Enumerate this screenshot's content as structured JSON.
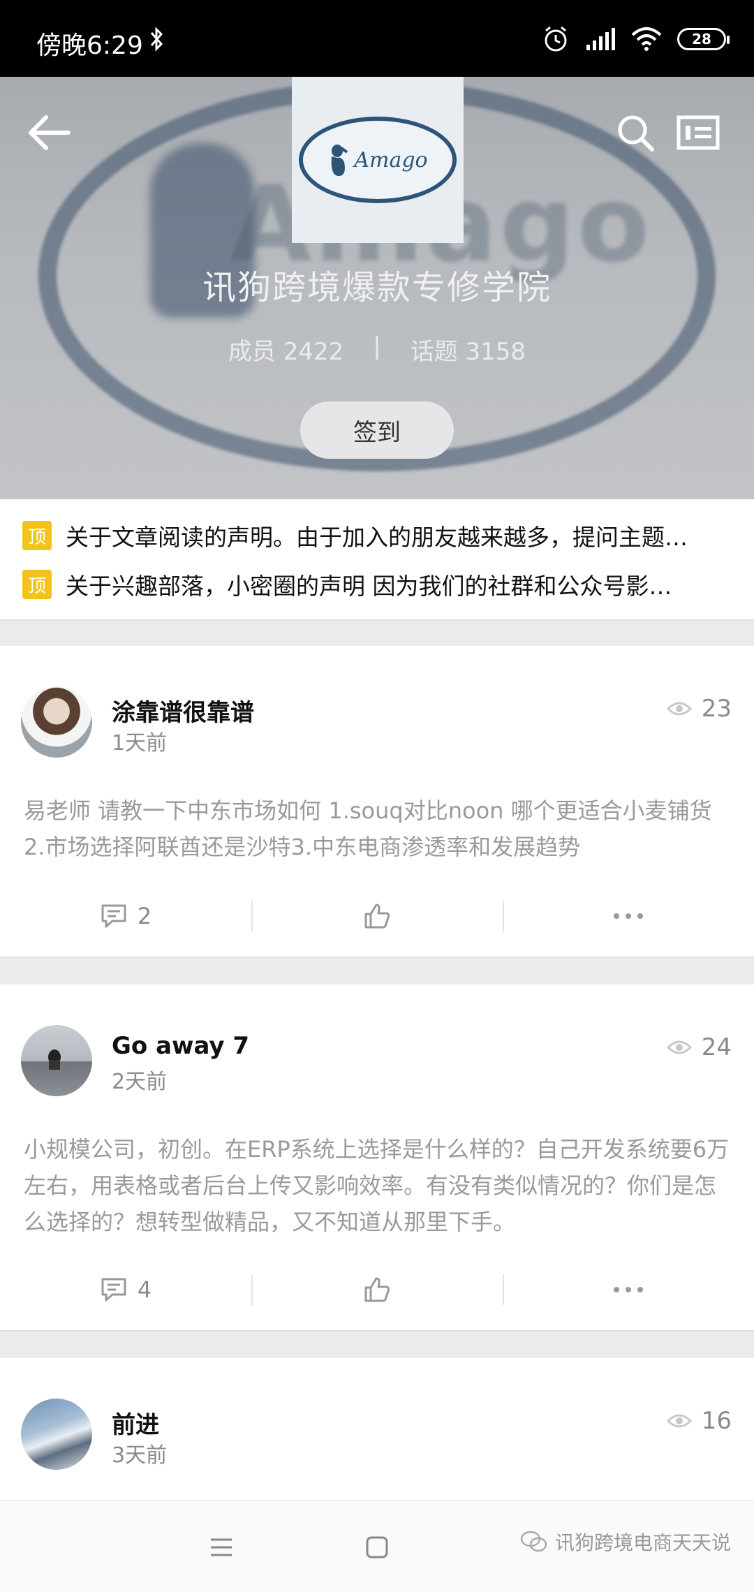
{
  "status_bar": {
    "time": "傍晚6:29",
    "battery": "28"
  },
  "group": {
    "logo_text": "Amago",
    "title": "讯狗跨境爆款专修学院",
    "members_label": "成员 2422",
    "separator": "|",
    "topics_label": "话题 3158",
    "checkin_label": "签到"
  },
  "pinned": [
    {
      "badge": "顶",
      "text": "关于文章阅读的声明。由于加入的朋友越来越多，提问主题…"
    },
    {
      "badge": "顶",
      "text": "关于兴趣部落，小密圈的声明 因为我们的社群和公众号影…"
    }
  ],
  "posts": [
    {
      "author": "涂靠谱很靠谱",
      "time": "1天前",
      "views": "23",
      "content": "易老师 请教一下中东市场如何 1.souq对比noon 哪个更适合小麦铺货 2.市场选择阿联酋还是沙特3.中东电商渗透率和发展趋势",
      "comments": "2"
    },
    {
      "author": "Go away 7",
      "time": "2天前",
      "views": "24",
      "content": "小规模公司，初创。在ERP系统上选择是什么样的？自己开发系统要6万左右，用表格或者后台上传又影响效率。有没有类似情况的？你们是怎么选择的？想转型做精品，又不知道从那里下手。",
      "comments": "4"
    },
    {
      "author": "前进",
      "time": "3天前",
      "views": "16"
    }
  ],
  "watermark": "讯狗跨境电商天天说"
}
